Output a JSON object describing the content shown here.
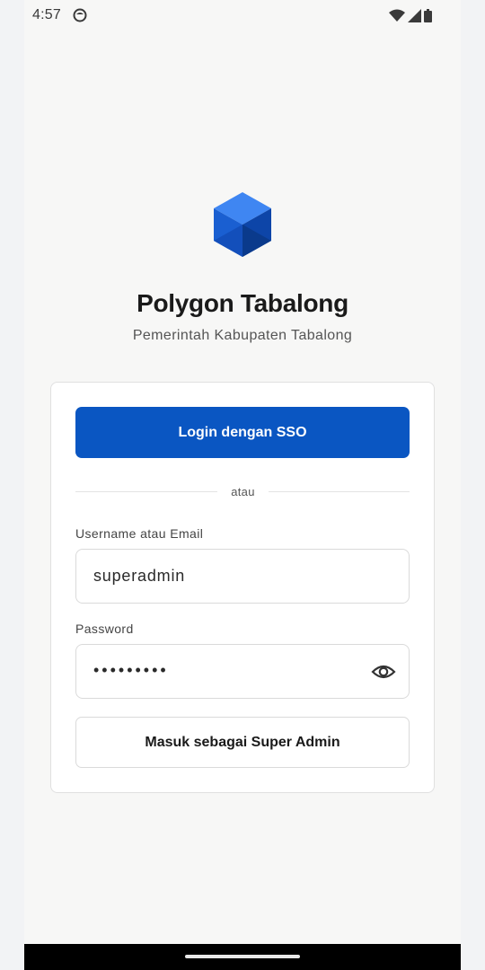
{
  "status_bar": {
    "time": "4:57",
    "icons": [
      "app-notification-icon",
      "wifi-icon",
      "cell-signal-icon",
      "battery-icon"
    ]
  },
  "app": {
    "title": "Polygon Tabalong",
    "subtitle": "Pemerintah Kabupaten Tabalong",
    "logo_icon": "hexagon-cube-logo",
    "brand_color": "#0a56c2"
  },
  "login": {
    "sso_button_label": "Login dengan SSO",
    "divider_text": "atau",
    "username_label": "Username atau Email",
    "username_value": "superadmin",
    "password_label": "Password",
    "password_masked": "•••••••••",
    "show_password_icon": "eye-icon",
    "superadmin_button_label": "Masuk sebagai Super Admin"
  }
}
